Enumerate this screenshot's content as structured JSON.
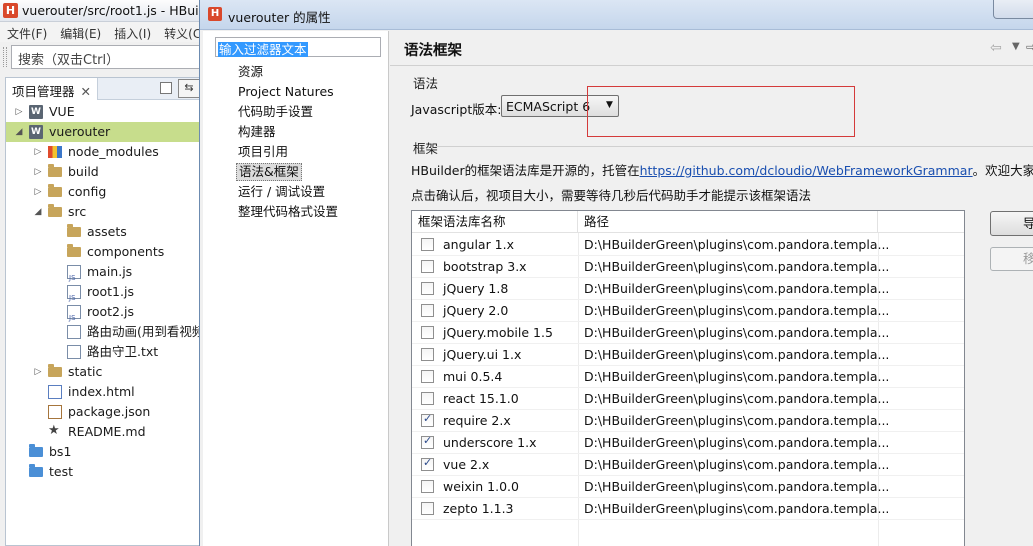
{
  "ide": {
    "title": "vuerouter/src/root1.js  -  HBuil",
    "menu": [
      "文件(F)",
      "编辑(E)",
      "插入(I)",
      "转义(C"
    ],
    "search_placeholder": "搜索（双击Ctrl）",
    "project_panel_title": "项目管理器",
    "tree": [
      {
        "label": "VUE",
        "icon": "project-icon",
        "depth": 0,
        "twisty": "collapsed"
      },
      {
        "label": "vuerouter",
        "icon": "project-icon",
        "depth": 0,
        "twisty": "expanded",
        "selected": true
      },
      {
        "label": "node_modules",
        "icon": "library-folder-icon",
        "depth": 1,
        "twisty": "collapsed"
      },
      {
        "label": "build",
        "icon": "folder-icon",
        "depth": 1,
        "twisty": "collapsed"
      },
      {
        "label": "config",
        "icon": "folder-icon",
        "depth": 1,
        "twisty": "collapsed"
      },
      {
        "label": "src",
        "icon": "folder-icon",
        "depth": 1,
        "twisty": "expanded"
      },
      {
        "label": "assets",
        "icon": "folder-icon",
        "depth": 2
      },
      {
        "label": "components",
        "icon": "folder-icon",
        "depth": 2
      },
      {
        "label": "main.js",
        "icon": "js-file-icon",
        "depth": 2
      },
      {
        "label": "root1.js",
        "icon": "js-file-icon",
        "depth": 2
      },
      {
        "label": "root2.js",
        "icon": "js-file-icon",
        "depth": 2
      },
      {
        "label": "路由动画(用到看视频",
        "icon": "text-file-icon",
        "depth": 2
      },
      {
        "label": "路由守卫.txt",
        "icon": "text-file-icon",
        "depth": 2
      },
      {
        "label": "static",
        "icon": "folder-icon",
        "depth": 1,
        "twisty": "collapsed"
      },
      {
        "label": "index.html",
        "icon": "html-file-icon",
        "depth": 1
      },
      {
        "label": "package.json",
        "icon": "json-file-icon",
        "depth": 1
      },
      {
        "label": "README.md",
        "icon": "star-icon",
        "depth": 1
      },
      {
        "label": "bs1",
        "icon": "blue-folder-icon",
        "depth": 0
      },
      {
        "label": "test",
        "icon": "blue-folder-icon",
        "depth": 0
      }
    ]
  },
  "dialog": {
    "title": "vuerouter 的属性",
    "filter_text": "输入过滤器文本",
    "nav_items": [
      {
        "label": "资源",
        "selected": false
      },
      {
        "label": "Project Natures",
        "selected": false
      },
      {
        "label": "代码助手设置",
        "selected": false
      },
      {
        "label": "构建器",
        "selected": false
      },
      {
        "label": "项目引用",
        "selected": false
      },
      {
        "label": "语法&框架",
        "selected": true
      },
      {
        "label": "运行 / 调试设置",
        "selected": false
      },
      {
        "label": "整理代码格式设置",
        "selected": false
      }
    ],
    "page_title": "语法框架",
    "grammar_group": "语法",
    "js_version_label": "Javascript版本:",
    "js_version_value": "ECMAScript 6",
    "framework_group": "框架",
    "framework_desc_prefix": "HBuilder的框架语法库是开源的，托管在",
    "framework_link": "https://github.com/dcloudio/WebFrameworkGrammar",
    "framework_desc_suffix": "。欢迎大家修改和",
    "framework_hint": "点击确认后，视项目大小，需要等待几秒后代码助手才能提示该框架语法",
    "table_headers": [
      "框架语法库名称",
      "路径"
    ],
    "frameworks": [
      {
        "name": "angular 1.x",
        "path": "D:\\HBuilderGreen\\plugins\\com.pandora.templa...",
        "checked": false
      },
      {
        "name": "bootstrap 3.x",
        "path": "D:\\HBuilderGreen\\plugins\\com.pandora.templa...",
        "checked": false
      },
      {
        "name": "jQuery 1.8",
        "path": "D:\\HBuilderGreen\\plugins\\com.pandora.templa...",
        "checked": false
      },
      {
        "name": "jQuery 2.0",
        "path": "D:\\HBuilderGreen\\plugins\\com.pandora.templa...",
        "checked": false
      },
      {
        "name": "jQuery.mobile 1.5",
        "path": "D:\\HBuilderGreen\\plugins\\com.pandora.templa...",
        "checked": false
      },
      {
        "name": "jQuery.ui 1.x",
        "path": "D:\\HBuilderGreen\\plugins\\com.pandora.templa...",
        "checked": false
      },
      {
        "name": "mui 0.5.4",
        "path": "D:\\HBuilderGreen\\plugins\\com.pandora.templa...",
        "checked": false
      },
      {
        "name": "react 15.1.0",
        "path": "D:\\HBuilderGreen\\plugins\\com.pandora.templa...",
        "checked": false
      },
      {
        "name": "require 2.x",
        "path": "D:\\HBuilderGreen\\plugins\\com.pandora.templa...",
        "checked": true
      },
      {
        "name": "underscore 1.x",
        "path": "D:\\HBuilderGreen\\plugins\\com.pandora.templa...",
        "checked": true
      },
      {
        "name": "vue 2.x",
        "path": "D:\\HBuilderGreen\\plugins\\com.pandora.templa...",
        "checked": true
      },
      {
        "name": "weixin 1.0.0",
        "path": "D:\\HBuilderGreen\\plugins\\com.pandora.templa...",
        "checked": false
      },
      {
        "name": "zepto 1.1.3",
        "path": "D:\\HBuilderGreen\\plugins\\com.pandora.templa...",
        "checked": false
      }
    ],
    "import_button": "导",
    "remove_button": "移"
  },
  "colors": {
    "selected_tree_row": "#c7dd8c",
    "highlight_box": "#d43a3a",
    "link": "#1a4fb0",
    "logo": "#d9482b"
  }
}
